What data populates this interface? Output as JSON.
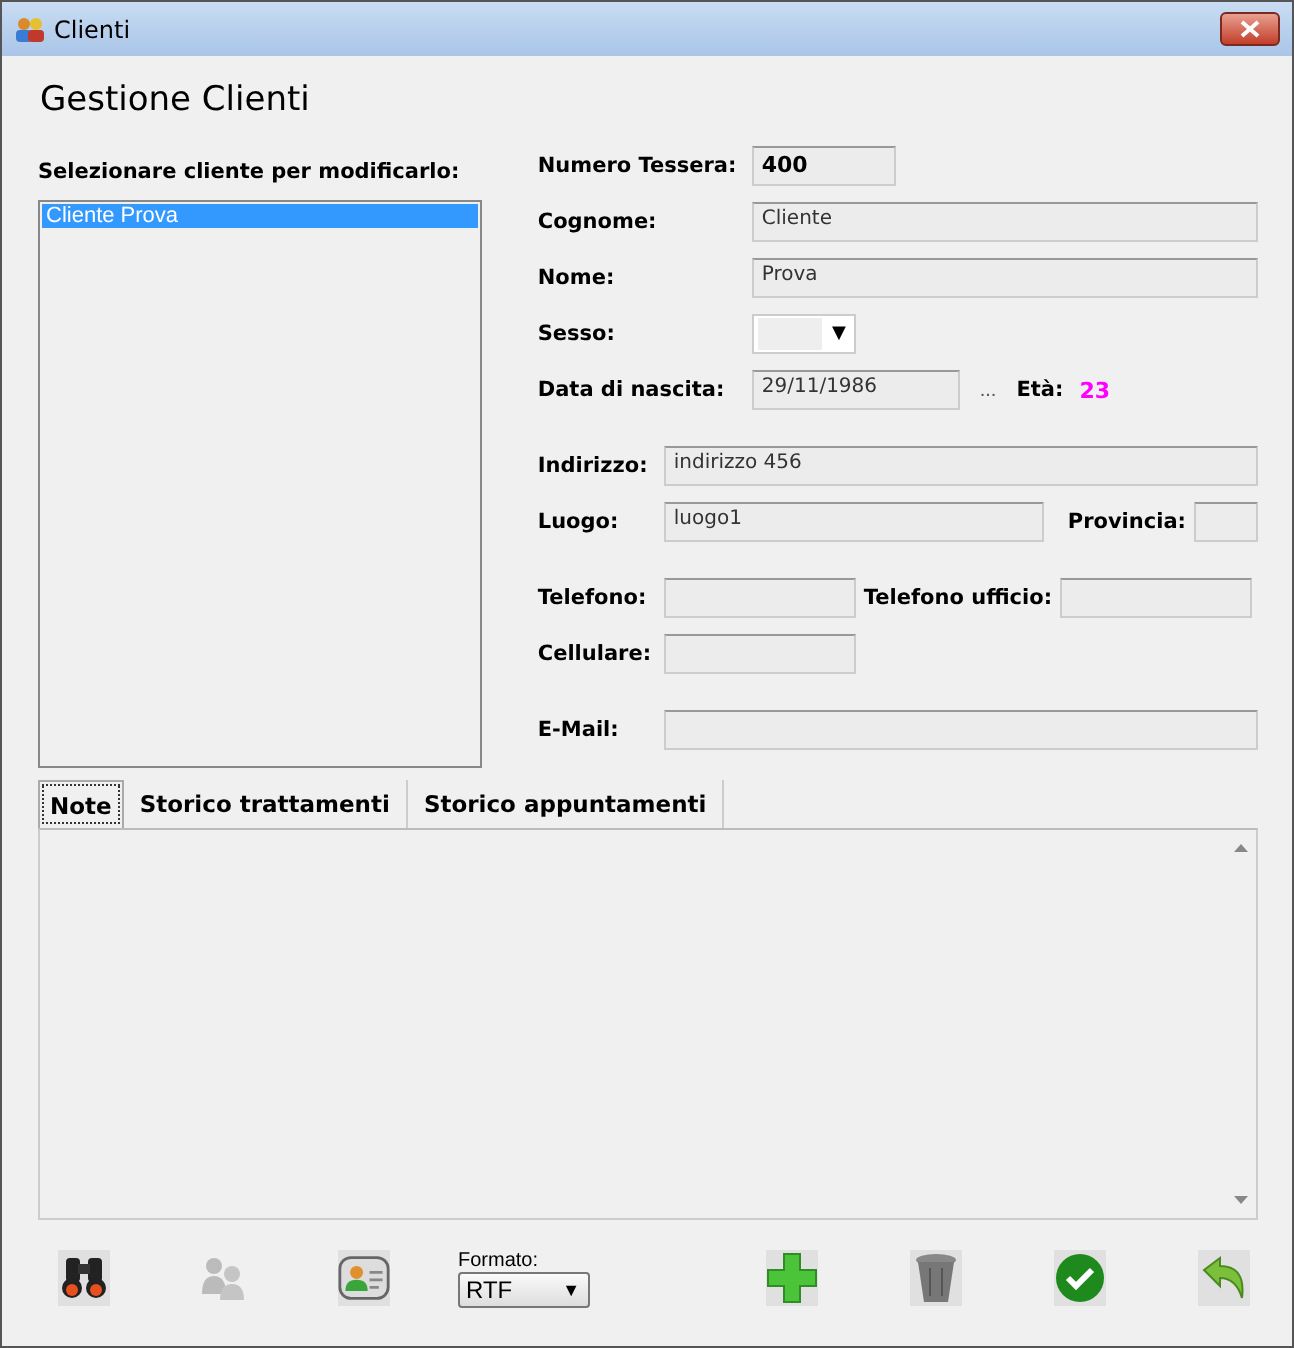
{
  "window": {
    "title": "Clienti"
  },
  "heading": "Gestione Clienti",
  "client_list": {
    "label": "Selezionare cliente per modificarlo:",
    "items": [
      {
        "name": "Cliente Prova",
        "selected": true
      }
    ]
  },
  "form": {
    "numero_tessera": {
      "label": "Numero Tessera:",
      "value": "400"
    },
    "cognome": {
      "label": "Cognome:",
      "value": "Cliente"
    },
    "nome": {
      "label": "Nome:",
      "value": "Prova"
    },
    "sesso": {
      "label": "Sesso:",
      "arrow": "▼"
    },
    "data_nascita": {
      "label": "Data di nascita:",
      "value": "29/11/1986",
      "picker": "..."
    },
    "eta": {
      "label": "Età:",
      "value": "23"
    },
    "indirizzo": {
      "label": "Indirizzo:",
      "value": "indirizzo 456"
    },
    "luogo": {
      "label": "Luogo:",
      "value": "luogo1"
    },
    "provincia": {
      "label": "Provincia:"
    },
    "telefono": {
      "label": "Telefono:"
    },
    "telefono_ufficio": {
      "label": "Telefono ufficio:"
    },
    "cellulare": {
      "label": "Cellulare:"
    },
    "email": {
      "label": "E-Mail:"
    }
  },
  "tabs": [
    {
      "label": "Note",
      "selected": true
    },
    {
      "label": "Storico trattamenti",
      "selected": false
    },
    {
      "label": "Storico appuntamenti",
      "selected": false
    }
  ],
  "toolbar_left": [
    {
      "kind": "binoculars",
      "disabled": false
    },
    {
      "kind": "people",
      "disabled": true
    },
    {
      "kind": "contact",
      "disabled": false
    }
  ],
  "formato": {
    "label": "Formato:",
    "value": "RTF",
    "arrow": "▼"
  },
  "toolbar_right": [
    {
      "kind": "add",
      "disabled": false
    },
    {
      "kind": "trash",
      "disabled": false
    },
    {
      "kind": "confirm",
      "disabled": false
    },
    {
      "kind": "undo",
      "disabled": false
    }
  ]
}
